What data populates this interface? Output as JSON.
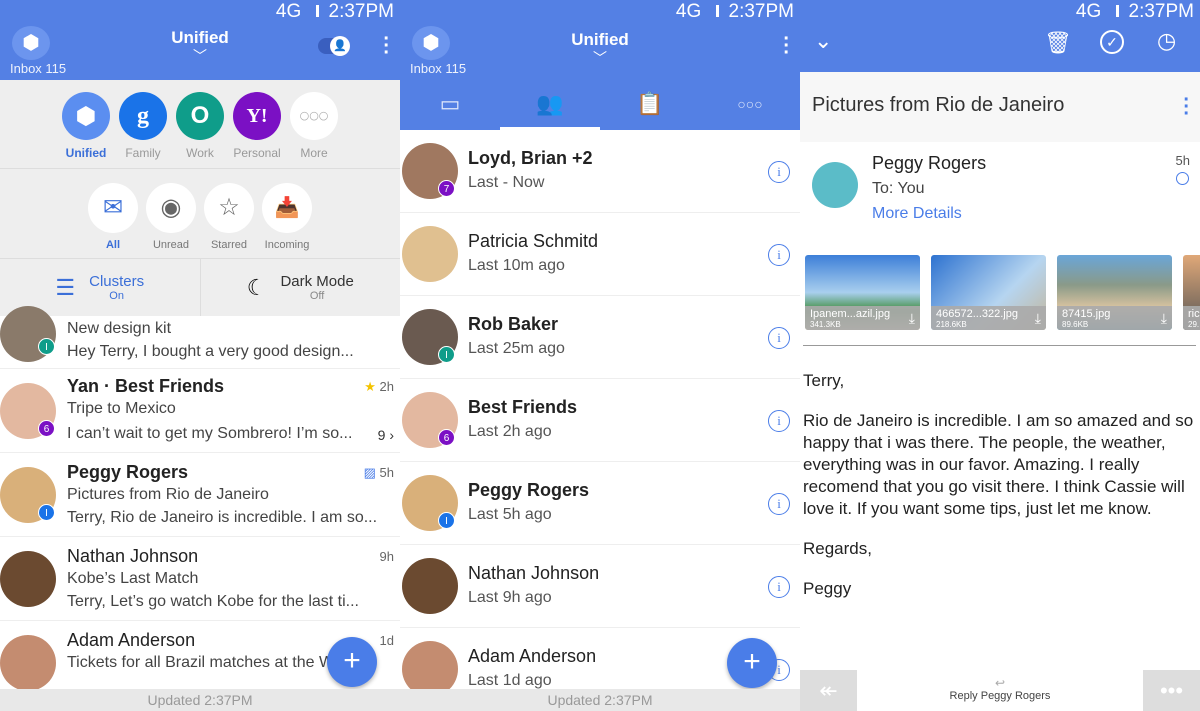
{
  "status": {
    "network": "4G",
    "time": "2:37PM"
  },
  "colors": {
    "primary": "#5480e4",
    "google": "#1a73e8",
    "work": "#0f9d8a",
    "yahoo": "#7b10c4"
  },
  "left": {
    "inbox": "Inbox 115",
    "title": "Unified",
    "accounts": [
      {
        "label": "Unified",
        "glyph": "⬢"
      },
      {
        "label": "Family",
        "glyph": "g"
      },
      {
        "label": "Work",
        "glyph": "O"
      },
      {
        "label": "Personal",
        "glyph": "Y!"
      },
      {
        "label": "More",
        "glyph": "○○○"
      }
    ],
    "filters": [
      {
        "label": "All",
        "glyph": "✉"
      },
      {
        "label": "Unread",
        "glyph": "◉"
      },
      {
        "label": "Starred",
        "glyph": "☆"
      },
      {
        "label": "Incoming",
        "glyph": "📥"
      }
    ],
    "clusters": {
      "label": "Clusters",
      "state": "On"
    },
    "dark_mode": {
      "label": "Dark Mode",
      "state": "Off"
    },
    "messages": [
      {
        "subject": "New design kit",
        "preview": "Hey Terry, I bought a very good design...",
        "badge": "I"
      },
      {
        "sender": "Yan · Best Friends",
        "subject": "Tripe to Mexico",
        "preview": "I can’t wait to get my Sombrero! I’m so...",
        "time": "2h",
        "count": "9 ›",
        "badge": "6",
        "starred": true
      },
      {
        "sender": "Peggy Rogers",
        "subject": "Pictures from Rio de Janeiro",
        "preview": "Terry, Rio de Janeiro is incredible. I am so...",
        "time": "5h",
        "badge": "I",
        "has_image": true
      },
      {
        "sender": "Nathan Johnson",
        "subject": "Kobe’s Last Match",
        "preview": "Terry, Let’s go watch Kobe for the last ti...",
        "time": "9h"
      },
      {
        "sender": "Adam Anderson",
        "subject": "Tickets for all Brazil matches at the W",
        "time": "1d"
      }
    ],
    "footer": "Updated 2:37PM"
  },
  "middle": {
    "inbox": "Inbox 115",
    "title": "Unified",
    "contacts": [
      {
        "name": "Loyd, Brian +2",
        "sub": "Last - Now",
        "badge": "7"
      },
      {
        "name": "Patricia Schmitd",
        "sub": "Last 10m ago"
      },
      {
        "name": "Rob Baker",
        "sub": "Last 25m ago",
        "badge": "I"
      },
      {
        "name": "Best Friends",
        "sub": "Last 2h ago",
        "badge": "6"
      },
      {
        "name": "Peggy Rogers",
        "sub": "Last 5h ago",
        "badge": "I"
      },
      {
        "name": "Nathan Johnson",
        "sub": "Last 9h ago"
      },
      {
        "name": "Adam Anderson",
        "sub": "Last 1d ago"
      }
    ],
    "footer": "Updated 2:37PM"
  },
  "right": {
    "subject": "Pictures from Rio de Janeiro",
    "sender": "Peggy Rogers",
    "to": "To: You",
    "more": "More Details",
    "time": "5h",
    "attachments": [
      {
        "name": "Ipanem...azil.jpg",
        "size": "341.3KB"
      },
      {
        "name": "466572...322.jpg",
        "size": "218.6KB"
      },
      {
        "name": "87415.jpg",
        "size": "89.6KB"
      },
      {
        "name": "ric",
        "size": "29."
      }
    ],
    "body": [
      "Terry,",
      "Rio de Janeiro is incredible. I am so amazed and so happy that i was there. The people, the weather, everything was in our favor. Amazing. I really recomend that you go visit there. I think Cassie will love it. If you want some tips, just let me know.",
      "Regards,",
      "Peggy"
    ],
    "reply": "Reply Peggy Rogers"
  }
}
